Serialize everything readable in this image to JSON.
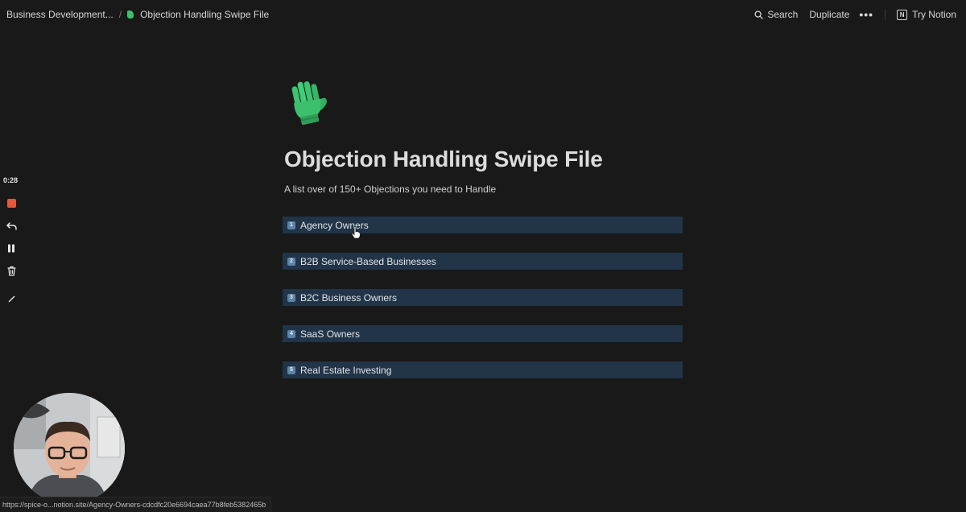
{
  "breadcrumb": {
    "parent": "Business Development...",
    "separator": "/",
    "current": "Objection Handling Swipe File"
  },
  "actions": {
    "search": "Search",
    "duplicate": "Duplicate",
    "more": "•••",
    "try_notion": "Try Notion",
    "notion_logo": "N"
  },
  "page": {
    "icon": "green-glove-icon",
    "title": "Objection Handling Swipe File",
    "subtitle": "A list over of 150+ Objections you need to Handle"
  },
  "items": [
    {
      "num": "1",
      "label": "Agency Owners"
    },
    {
      "num": "2",
      "label": "B2B Service-Based Businesses"
    },
    {
      "num": "3",
      "label": "B2C Business Owners"
    },
    {
      "num": "4",
      "label": "SaaS Owners"
    },
    {
      "num": "5",
      "label": "Real Estate Investing"
    }
  ],
  "recorder": {
    "timer": "0:28",
    "buttons": [
      "stop-icon",
      "undo-icon",
      "pause-icon",
      "trash-icon",
      "pen-icon"
    ]
  },
  "status_url": "https://spice-o...notion.site/Agency-Owners-cdcdfc20e6694caea77b8feb5382465b",
  "colors": {
    "background": "#191919",
    "callout": "#213448",
    "number_badge": "#5d84a8",
    "record": "#e5573f"
  }
}
